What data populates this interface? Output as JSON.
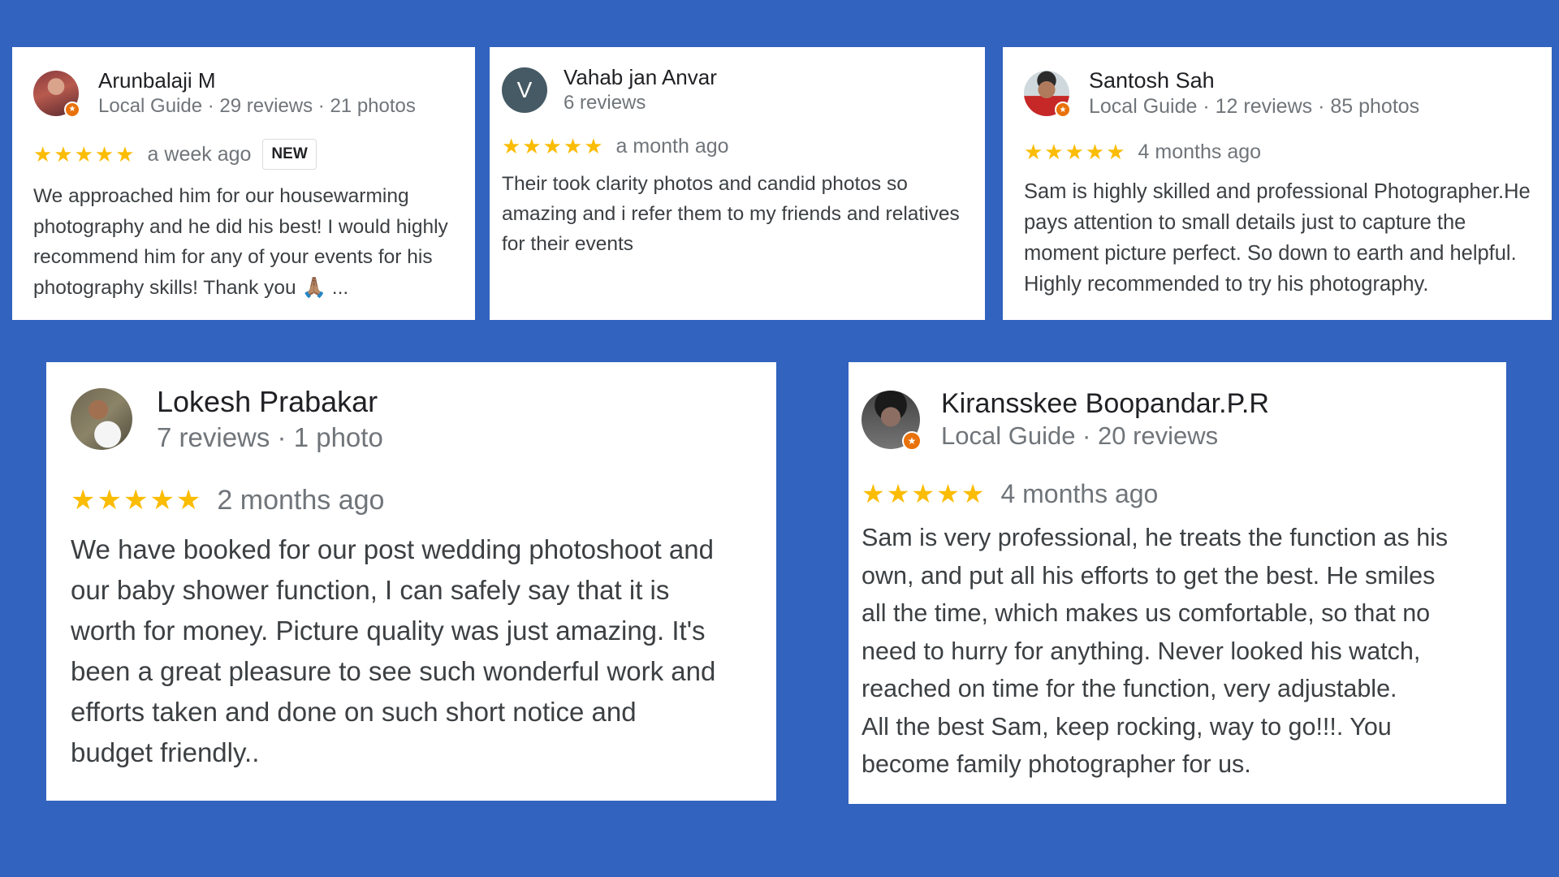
{
  "colors": {
    "background": "#3163bf",
    "card": "#ffffff",
    "star": "#fbbc04",
    "local_guide_badge": "#e8710a",
    "letter_avatar": "#455a64"
  },
  "reviews": [
    {
      "name": "Arunbalaji M",
      "meta": "Local Guide · 29 reviews · 21 photos",
      "avatar_icon": "profile-photo",
      "local_guide": true,
      "rating": 5,
      "stars": "★★★★★",
      "time": "a week ago",
      "badge": "NEW",
      "text": "We approached him for our housewarming\nphotography and he did his best! I would highly\nrecommend him for any of your events for his\nphotography skills! Thank you 🙏🏽 ..."
    },
    {
      "name": "Vahab jan Anvar",
      "meta": "6 reviews",
      "avatar_letter": "V",
      "local_guide": false,
      "rating": 5,
      "stars": "★★★★★",
      "time": "a month ago",
      "text": "Their took clarity photos and candid photos so\namazing and i refer them to my friends and relatives\nfor their events"
    },
    {
      "name": "Santosh Sah",
      "meta": "Local Guide · 12 reviews · 85 photos",
      "avatar_icon": "profile-photo",
      "local_guide": true,
      "rating": 5,
      "stars": "★★★★★",
      "time": "4 months ago",
      "text": "Sam is highly skilled and professional Photographer.He\npays attention to small details just to capture the\nmoment picture perfect. So down to earth and helpful.\nHighly recommended to try his photography."
    },
    {
      "name": "Lokesh Prabakar",
      "meta": "7 reviews · 1 photo",
      "avatar_icon": "profile-photo",
      "local_guide": false,
      "rating": 5,
      "stars": "★★★★★",
      "time": "2 months ago",
      "text": "We have booked for our post wedding photoshoot and\nour baby shower function, I can safely say that it is\nworth for money. Picture quality was just amazing. It's\nbeen a great pleasure to see such wonderful work and\nefforts taken and done on such short notice and\nbudget friendly.."
    },
    {
      "name": "Kiransskee Boopandar.P.R",
      "meta": "Local Guide · 20 reviews",
      "avatar_icon": "profile-photo",
      "local_guide": true,
      "rating": 5,
      "stars": "★★★★★",
      "time": "4 months ago",
      "text": "Sam is very professional, he treats the function as his\nown, and put all his efforts to get the best. He smiles\nall the time, which makes us comfortable, so that no\nneed to hurry for anything. Never looked his watch,\nreached on time for the function, very adjustable.\nAll the best Sam, keep rocking, way to go!!!. You\nbecome family photographer for us."
    }
  ]
}
